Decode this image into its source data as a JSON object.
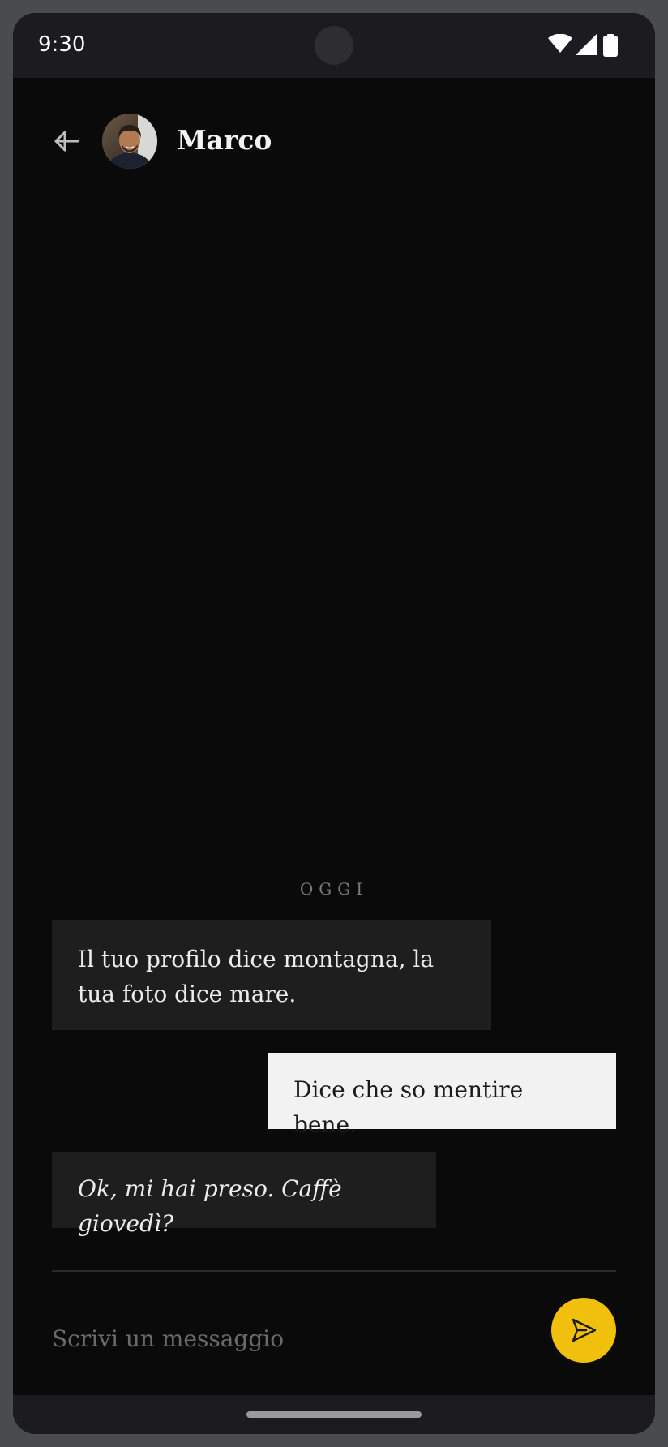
{
  "status_bar": {
    "time": "9:30",
    "icons": [
      "wifi-icon",
      "signal-icon",
      "battery-icon"
    ]
  },
  "header": {
    "back_icon": "arrow-left-icon",
    "contact_name": "Marco"
  },
  "conversation": {
    "date_separator": "OGGI",
    "messages": [
      {
        "direction": "incoming",
        "text": "Il tuo profilo dice montagna, la tua foto dice mare.",
        "style": "normal"
      },
      {
        "direction": "outgoing",
        "text": "Dice che so mentire bene.",
        "style": "normal"
      },
      {
        "direction": "incoming",
        "text": "Ok, mi hai preso. Caffè giovedì?",
        "style": "italic"
      }
    ]
  },
  "composer": {
    "placeholder": "Scrivi un messaggio",
    "value": "",
    "send_icon": "send-icon"
  },
  "colors": {
    "background": "#0a0a0a",
    "incoming_bubble": "#1e1e1e",
    "outgoing_bubble": "#f2f2f2",
    "accent": "#f0c00c"
  }
}
